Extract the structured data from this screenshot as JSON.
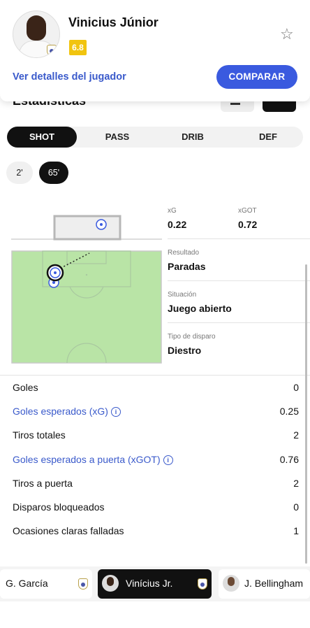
{
  "player": {
    "name": "Vinicius Júnior",
    "rating": "6.8",
    "details_link": "Ver detalles del jugador",
    "compare_label": "COMPARAR"
  },
  "section": {
    "title": "Estadísticas"
  },
  "tabs": [
    {
      "label": "SHOT",
      "active": true
    },
    {
      "label": "PASS",
      "active": false
    },
    {
      "label": "DRIB",
      "active": false
    },
    {
      "label": "DEF",
      "active": false
    }
  ],
  "shots": [
    {
      "label": "2'",
      "active": false
    },
    {
      "label": "65'",
      "active": true
    }
  ],
  "shot_stats": {
    "xg_label": "xG",
    "xg": "0.22",
    "xgot_label": "xGOT",
    "xgot": "0.72",
    "result_label": "Resultado",
    "result": "Paradas",
    "situation_label": "Situación",
    "situation": "Juego abierto",
    "shot_type_label": "Tipo de disparo",
    "shot_type": "Diestro"
  },
  "stats": [
    {
      "label": "Goles",
      "value": "0",
      "info": false
    },
    {
      "label": "Goles esperados (xG)",
      "value": "0.25",
      "info": true
    },
    {
      "label": "Tiros totales",
      "value": "2",
      "info": false
    },
    {
      "label": "Goles esperados a puerta (xGOT)",
      "value": "0.76",
      "info": true
    },
    {
      "label": "Tiros a puerta",
      "value": "2",
      "info": false
    },
    {
      "label": "Disparos bloqueados",
      "value": "0",
      "info": false
    },
    {
      "label": "Ocasiones claras falladas",
      "value": "1",
      "info": false
    }
  ],
  "players": [
    {
      "name": "G. García",
      "active": false
    },
    {
      "name": "Vinícius Jr.",
      "active": true
    },
    {
      "name": "J. Bellingham",
      "active": false
    }
  ],
  "colors": {
    "accent": "#3a5adf",
    "link": "#3a5acb",
    "rating": "#f1c40f",
    "pitch": "#b9e4a6",
    "active_tab": "#111111"
  },
  "icons": [
    "star-icon",
    "info-icon",
    "club-crest-icon",
    "goal-view-icon",
    "shot-marker-icon"
  ]
}
